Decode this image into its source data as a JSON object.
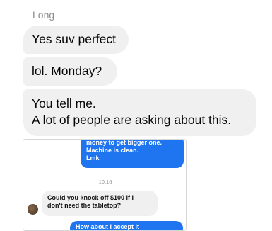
{
  "conversation": {
    "sender_name": "Long",
    "messages": [
      {
        "lines": [
          "Yes suv perfect"
        ]
      },
      {
        "lines": [
          "lol. Monday?"
        ]
      },
      {
        "lines": [
          "You tell me.",
          "A lot of people are asking about this."
        ]
      }
    ]
  },
  "attachment": {
    "outgoing_lines": [
      "money to get bigger one.",
      "Machine is clean.",
      "Lmk"
    ],
    "timestamp": "10:16",
    "incoming_lines": [
      "Could you knock off $100 if I",
      "don't need the tabletop?"
    ],
    "partial_outgoing": "How about I accept it"
  },
  "colors": {
    "incoming_bubble": "#f0f0f0",
    "outgoing_bubble": "#1f74ef",
    "sender_label": "#8a8d91"
  }
}
